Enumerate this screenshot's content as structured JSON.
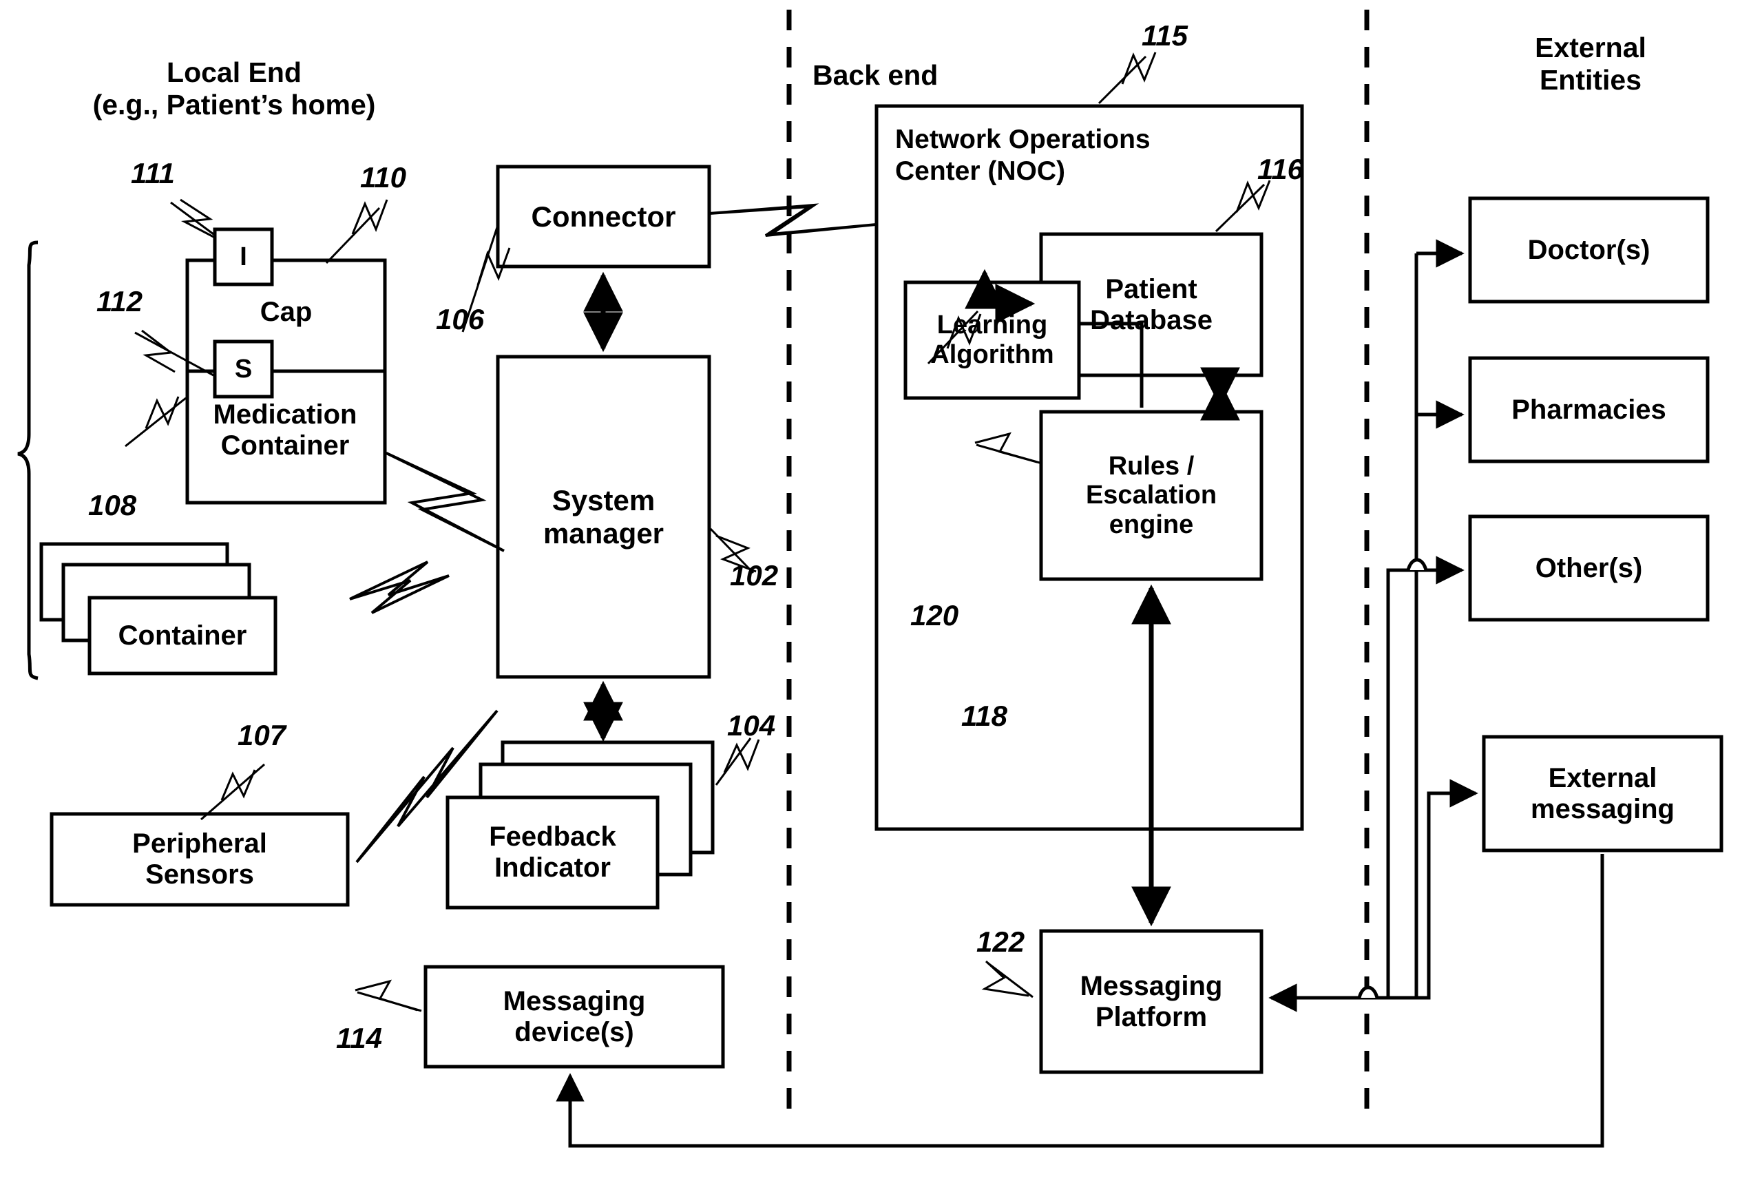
{
  "figure": {
    "type": "patent-block-diagram",
    "background": "#ffffff",
    "stroke": "#000000"
  },
  "sections": {
    "local_end": {
      "title_line1": "Local End",
      "title_line2": "(e.g., Patient’s home)"
    },
    "back_end": {
      "title": "Back end"
    },
    "external_entities": {
      "title_line1": "External",
      "title_line2": "Entities"
    }
  },
  "noc": {
    "title_line1": "Network Operations",
    "title_line2": "Center (NOC)"
  },
  "blocks": {
    "indicator": "I",
    "sensor": "S",
    "cap": "Cap",
    "medication_container_line1": "Medication",
    "medication_container_line2": "Container",
    "container": "Container",
    "peripheral_sensors_line1": "Peripheral",
    "peripheral_sensors_line2": "Sensors",
    "connector": "Connector",
    "system_manager_line1": "System",
    "system_manager_line2": "manager",
    "feedback_indicator_line1": "Feedback",
    "feedback_indicator_line2": "Indicator",
    "messaging_devices_line1": "Messaging",
    "messaging_devices_line2": "device(s)",
    "patient_database_line1": "Patient",
    "patient_database_line2": "Database",
    "learning_algorithm_line1": "Learning",
    "learning_algorithm_line2": "Algorithm",
    "rules_engine_line1": "Rules /",
    "rules_engine_line2": "Escalation",
    "rules_engine_line3": "engine",
    "messaging_platform_line1": "Messaging",
    "messaging_platform_line2": "Platform",
    "doctors": "Doctor(s)",
    "pharmacies": "Pharmacies",
    "others": "Other(s)",
    "external_messaging_line1": "External",
    "external_messaging_line2": "messaging"
  },
  "reference_numerals": {
    "n102": "102",
    "n104": "104",
    "n106": "106",
    "n107": "107",
    "n108": "108",
    "n110": "110",
    "n111": "111",
    "n112": "112",
    "n114": "114",
    "n115": "115",
    "n116": "116",
    "n118": "118",
    "n120": "120",
    "n122": "122"
  }
}
